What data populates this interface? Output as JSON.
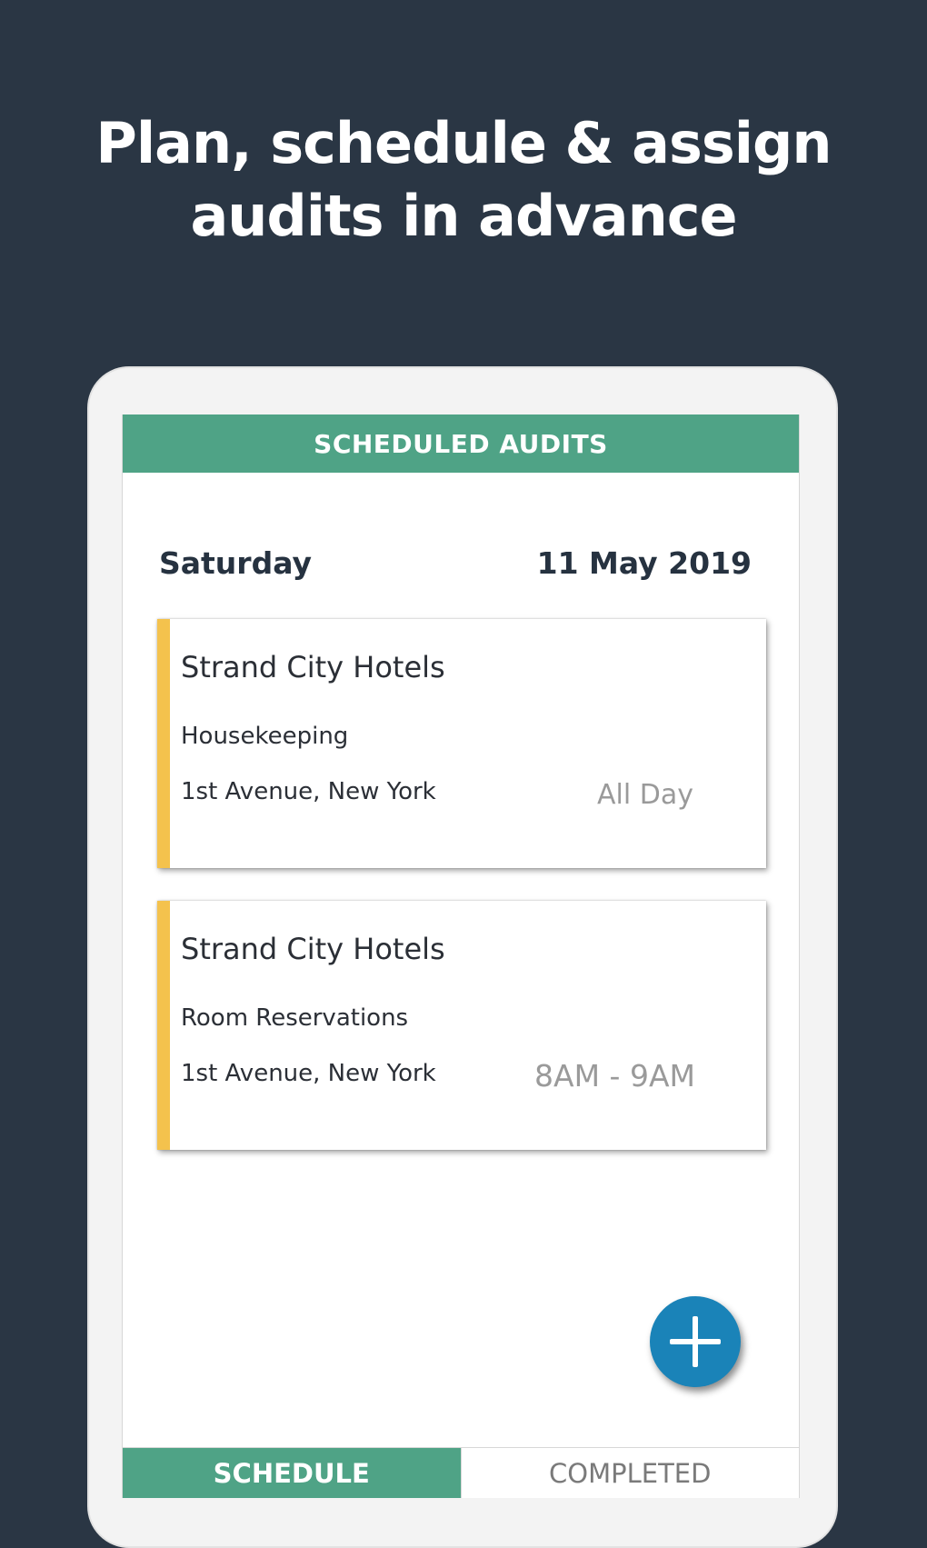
{
  "headline": {
    "line1": "Plan, schedule & assign",
    "line2": "audits in advance"
  },
  "app_bar": {
    "title": "SCHEDULED AUDITS"
  },
  "date_header": {
    "day": "Saturday",
    "date": "11 May 2019"
  },
  "audits": [
    {
      "title": "Strand City Hotels",
      "department": "Housekeeping",
      "address": "1st Avenue, New York",
      "time": "All Day"
    },
    {
      "title": "Strand City Hotels",
      "department": "Room Reservations",
      "address": "1st Avenue, New York",
      "time": "8AM - 9AM"
    }
  ],
  "fab": {
    "icon": "plus-icon"
  },
  "tabs": [
    {
      "label": "SCHEDULE",
      "active": true
    },
    {
      "label": "COMPLETED",
      "active": false
    }
  ],
  "colors": {
    "background": "#2a3644",
    "accent": "#4fa386",
    "card_stripe": "#f4c24d",
    "fab": "#1a83b8"
  }
}
